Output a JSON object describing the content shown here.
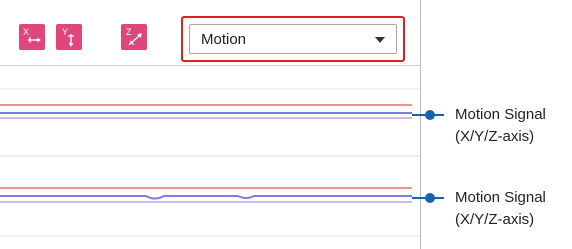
{
  "toolbar": {
    "axis_buttons": [
      {
        "letter": "X",
        "icon": "x-axis-arrow-icon"
      },
      {
        "letter": "Y",
        "icon": "y-axis-arrow-icon"
      },
      {
        "letter": "Z",
        "icon": "z-axis-arrow-icon"
      }
    ],
    "signal_select": {
      "value": "Motion"
    }
  },
  "callouts": [
    {
      "title": "Motion Signal",
      "subtitle": "(X/Y/Z-axis)"
    },
    {
      "title": "Motion Signal",
      "subtitle": "(X/Y/Z-axis)"
    }
  ],
  "colors": {
    "accent": "#e0457b",
    "highlight": "#e02020",
    "x_signal": "#f08080",
    "y_signal": "#7b7de0",
    "z_signal": "#c0a0e0",
    "callout": "#1a5fb0"
  }
}
